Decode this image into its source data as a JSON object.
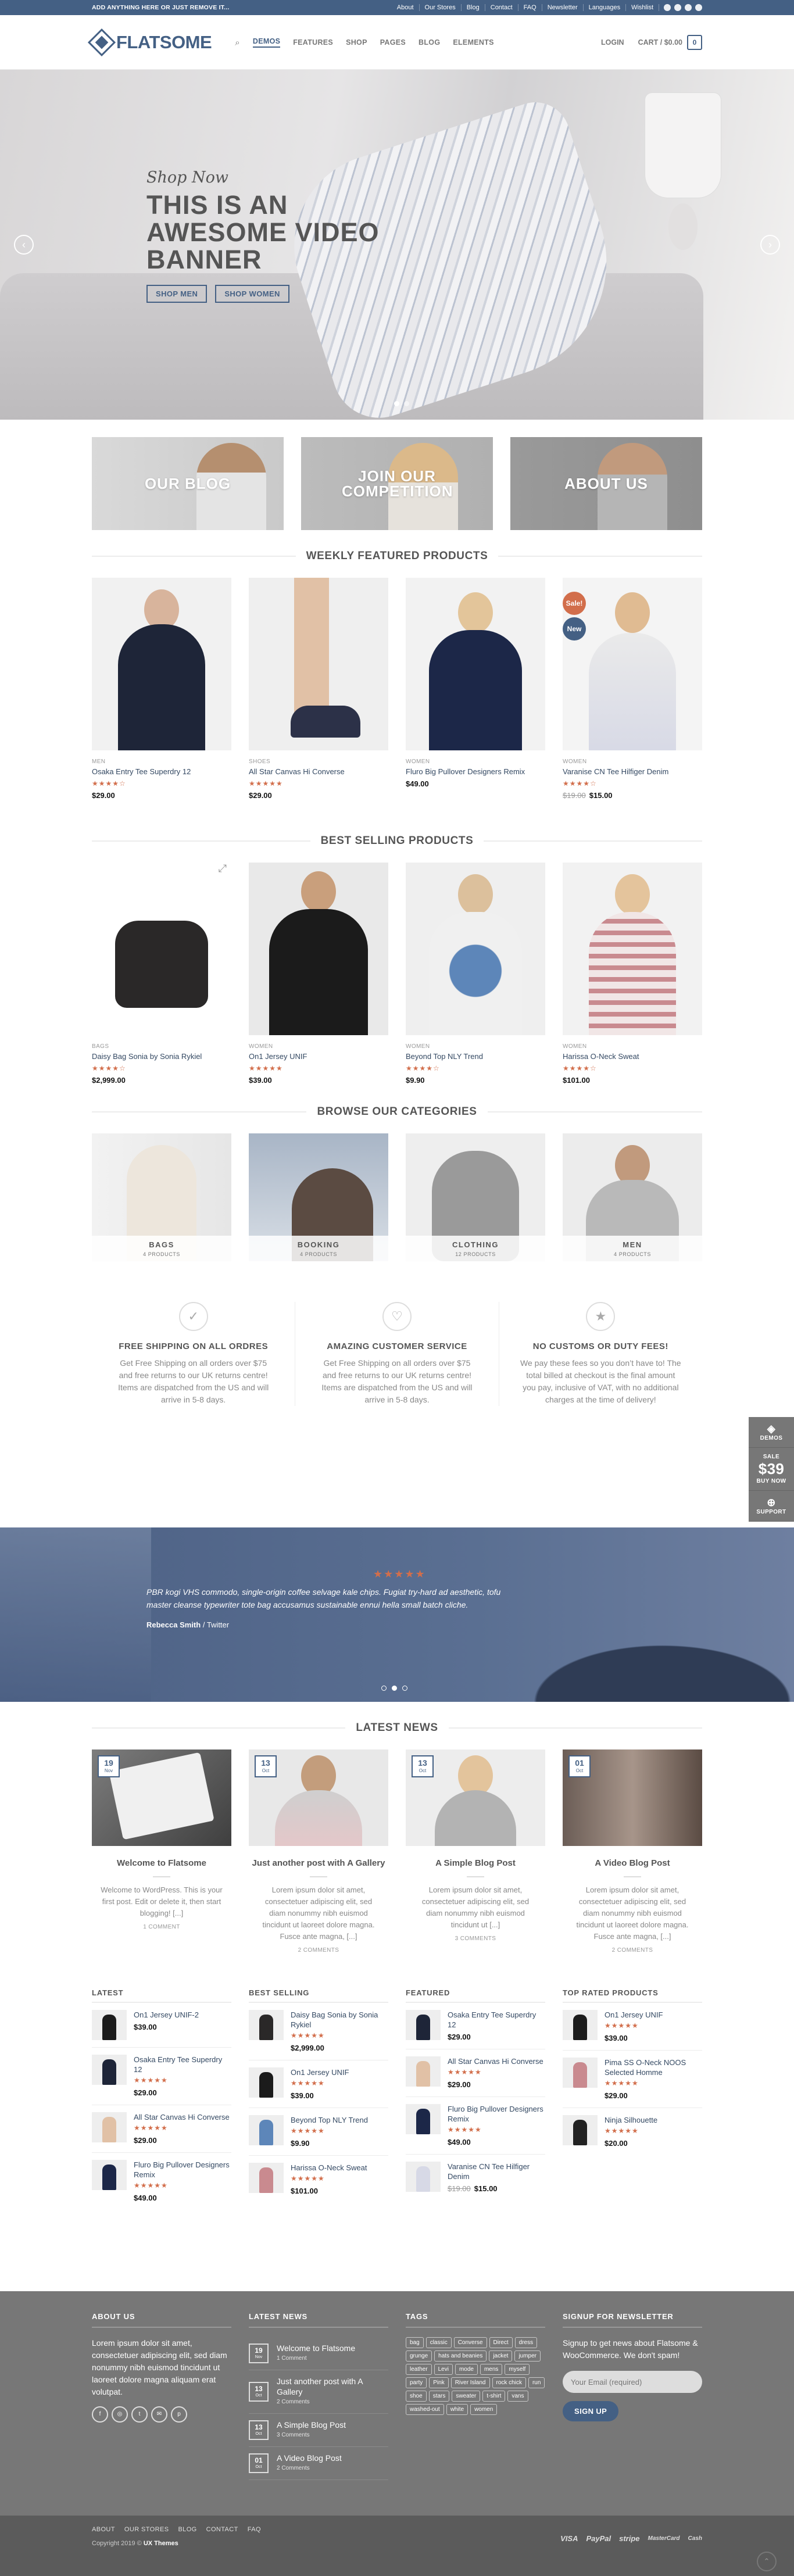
{
  "topbar": {
    "promo": "ADD ANYTHING HERE OR JUST REMOVE IT...",
    "links": [
      "About",
      "Our Stores",
      "Blog",
      "Contact",
      "FAQ",
      "Newsletter",
      "Languages",
      "Wishlist"
    ]
  },
  "header": {
    "logo": "FLATSOME",
    "nav": [
      "DEMOS",
      "FEATURES",
      "SHOP",
      "PAGES",
      "BLOG",
      "ELEMENTS"
    ],
    "login": "LOGIN",
    "cart": "CART / $0.00",
    "cart_count": "0"
  },
  "hero": {
    "pretitle": "Shop Now",
    "title": "THIS IS AN AWESOME VIDEO BANNER",
    "btn1": "SHOP MEN",
    "btn2": "SHOP WOMEN"
  },
  "banners": [
    "OUR BLOG",
    "JOIN OUR COMPETITION",
    "ABOUT US"
  ],
  "featured": {
    "title": "WEEKLY FEATURED PRODUCTS",
    "products": [
      {
        "cat": "MEN",
        "name": "Osaka Entry Tee Superdry 12",
        "price": "$29.00",
        "old": ""
      },
      {
        "cat": "SHOES",
        "name": "All Star Canvas Hi Converse",
        "price": "$29.00",
        "old": ""
      },
      {
        "cat": "WOMEN",
        "name": "Fluro Big Pullover Designers Remix",
        "price": "$49.00",
        "old": ""
      },
      {
        "cat": "WOMEN",
        "name": "Varanise CN Tee Hilfiger Denim",
        "price": "$15.00",
        "old": "$19.00"
      }
    ],
    "badges": {
      "sale": "Sale!",
      "new": "New"
    }
  },
  "bestselling": {
    "title": "BEST SELLING PRODUCTS",
    "products": [
      {
        "cat": "BAGS",
        "name": "Daisy Bag Sonia by Sonia Rykiel",
        "price": "$2,999.00"
      },
      {
        "cat": "WOMEN",
        "name": "On1 Jersey UNIF",
        "price": "$39.00"
      },
      {
        "cat": "WOMEN",
        "name": "Beyond Top NLY Trend",
        "price": "$9.90"
      },
      {
        "cat": "WOMEN",
        "name": "Harissa O-Neck Sweat",
        "price": "$101.00"
      }
    ]
  },
  "categories": {
    "title": "BROWSE OUR CATEGORIES",
    "items": [
      {
        "name": "BAGS",
        "count": "4 PRODUCTS"
      },
      {
        "name": "BOOKING",
        "count": "4 PRODUCTS"
      },
      {
        "name": "CLOTHING",
        "count": "12 PRODUCTS"
      },
      {
        "name": "MEN",
        "count": "4 PRODUCTS"
      }
    ]
  },
  "features": [
    {
      "title": "FREE SHIPPING ON ALL ORDRES",
      "text": "Get Free Shipping on all orders over $75 and free returns to our UK returns centre! Items are dispatched from the US and will arrive in 5-8 days."
    },
    {
      "title": "AMAZING CUSTOMER SERVICE",
      "text": "Get Free Shipping on all orders over $75 and free returns to our UK returns centre! Items are dispatched from the US and will arrive in 5-8 days."
    },
    {
      "title": "NO CUSTOMS OR DUTY FEES!",
      "text": "We pay these fees so you don’t have to! The total billed at checkout is the final amount you pay, inclusive of VAT, with no additional charges at the time of delivery!"
    }
  ],
  "testimonial": {
    "quote": "PBR kogi VHS commodo, single-origin coffee selvage kale chips. Fugiat try-hard ad aesthetic, tofu master cleanse typewriter tote bag accusamus sustainable ennui hella small batch cliche.",
    "author": "Rebecca Smith",
    "source": "Twitter"
  },
  "sidetabs": {
    "demos": "DEMOS",
    "sale": "SALE",
    "price": "$39",
    "buy": "BUY NOW",
    "support": "SUPPORT"
  },
  "news": {
    "title": "LATEST NEWS",
    "posts": [
      {
        "day": "19",
        "mon": "Nov",
        "title": "Welcome to Flatsome",
        "excerpt": "Welcome to WordPress. This is your first post. Edit or delete it, then start blogging! [...]",
        "comments": "1 COMMENT"
      },
      {
        "day": "13",
        "mon": "Oct",
        "title": "Just another post with A Gallery",
        "excerpt": "Lorem ipsum dolor sit amet, consectetuer adipiscing elit, sed diam nonummy nibh euismod tincidunt ut laoreet dolore magna. Fusce ante magna, [...]",
        "comments": "2 COMMENTS"
      },
      {
        "day": "13",
        "mon": "Oct",
        "title": "A Simple Blog Post",
        "excerpt": "Lorem ipsum dolor sit amet, consectetuer adipiscing elit, sed diam nonummy nibh euismod tincidunt ut [...]",
        "comments": "3 COMMENTS"
      },
      {
        "day": "01",
        "mon": "Oct",
        "title": "A Video Blog Post",
        "excerpt": "Lorem ipsum dolor sit amet, consectetuer adipiscing elit, sed diam nonummy nibh euismod tincidunt ut laoreet dolore magna. Fusce ante magna, [...]",
        "comments": "2 COMMENTS"
      }
    ]
  },
  "widgets": [
    {
      "title": "LATEST",
      "items": [
        {
          "name": "On1 Jersey UNIF-2",
          "price": "$39.00",
          "old": "",
          "stars": false
        },
        {
          "name": "Osaka Entry Tee Superdry 12",
          "price": "$29.00",
          "old": "",
          "stars": true
        },
        {
          "name": "All Star Canvas Hi Converse",
          "price": "$29.00",
          "old": "",
          "stars": true
        },
        {
          "name": "Fluro Big Pullover Designers Remix",
          "price": "$49.00",
          "old": "",
          "stars": true
        }
      ]
    },
    {
      "title": "BEST SELLING",
      "items": [
        {
          "name": "Daisy Bag Sonia by Sonia Rykiel",
          "price": "$2,999.00",
          "old": "",
          "stars": true
        },
        {
          "name": "On1 Jersey UNIF",
          "price": "$39.00",
          "old": "",
          "stars": true
        },
        {
          "name": "Beyond Top NLY Trend",
          "price": "$9.90",
          "old": "",
          "stars": true
        },
        {
          "name": "Harissa O-Neck Sweat",
          "price": "$101.00",
          "old": "",
          "stars": true
        }
      ]
    },
    {
      "title": "FEATURED",
      "items": [
        {
          "name": "Osaka Entry Tee Superdry 12",
          "price": "$29.00",
          "old": "",
          "stars": false
        },
        {
          "name": "All Star Canvas Hi Converse",
          "price": "$29.00",
          "old": "",
          "stars": true
        },
        {
          "name": "Fluro Big Pullover Designers Remix",
          "price": "$49.00",
          "old": "",
          "stars": true
        },
        {
          "name": "Varanise CN Tee Hilfiger Denim",
          "price": "$15.00",
          "old": "$19.00",
          "stars": false
        }
      ]
    },
    {
      "title": "TOP RATED PRODUCTS",
      "items": [
        {
          "name": "On1 Jersey UNIF",
          "price": "$39.00",
          "old": "",
          "stars": true
        },
        {
          "name": "Pima SS O-Neck NOOS Selected Homme",
          "price": "$29.00",
          "old": "",
          "stars": true
        },
        {
          "name": "Ninja Silhouette",
          "price": "$20.00",
          "old": "",
          "stars": true
        }
      ]
    }
  ],
  "footer": {
    "about_title": "ABOUT US",
    "about_text": "Lorem ipsum dolor sit amet, consectetuer adipiscing elit, sed diam nonummy nibh euismod tincidunt ut laoreet dolore magna aliquam erat volutpat.",
    "news_title": "LATEST NEWS",
    "posts": [
      {
        "day": "19",
        "mon": "Nov",
        "title": "Welcome to Flatsome",
        "comments": "1 Comment"
      },
      {
        "day": "13",
        "mon": "Oct",
        "title": "Just another post with A Gallery",
        "comments": "2 Comments"
      },
      {
        "day": "13",
        "mon": "Oct",
        "title": "A Simple Blog Post",
        "comments": "3 Comments"
      },
      {
        "day": "01",
        "mon": "Oct",
        "title": "A Video Blog Post",
        "comments": "2 Comments"
      }
    ],
    "tags_title": "TAGS",
    "tags": [
      "bag",
      "classic",
      "Converse",
      "Direct",
      "dress",
      "grunge",
      "hats and beanies",
      "jacket",
      "jumper",
      "leather",
      "Levi",
      "mode",
      "mens",
      "myself",
      "party",
      "Pink",
      "River Island",
      "rock chick",
      "run",
      "shoe",
      "stars",
      "sweater",
      "t-shirt",
      "vans",
      "washed-out",
      "white",
      "women"
    ],
    "newsletter_title": "SIGNUP FOR NEWSLETTER",
    "newsletter_text": "Signup to get news about Flatsome & WooCommerce. We don't spam!",
    "email_placeholder": "Your Email (required)",
    "signup": "SIGN UP"
  },
  "bottom": {
    "menu": [
      "ABOUT",
      "OUR STORES",
      "BLOG",
      "CONTACT",
      "FAQ"
    ],
    "copyright": "Copyright 2019 ©",
    "brand": "UX Themes",
    "payments": [
      "VISA",
      "PayPal",
      "stripe",
      "MasterCard",
      "Cash"
    ]
  },
  "colors": {
    "primary": "#446084",
    "accent": "#d26e4b",
    "sale": "#d26e4b",
    "footer": "#777777"
  }
}
